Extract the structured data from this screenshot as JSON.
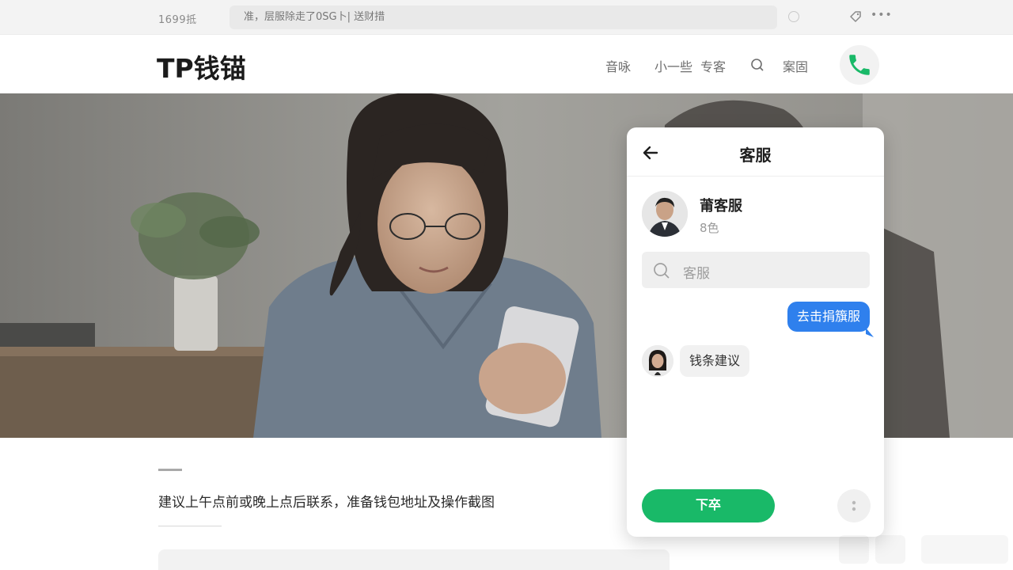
{
  "topbar": {
    "code": "1699抵",
    "notice": "准，层服除走了0SG卜| 送财措",
    "icons": [
      "clock-icon",
      "tag-icon",
      "more-icon"
    ]
  },
  "header": {
    "logo": "TP钱锚",
    "nav": [
      "音咏",
      "小一些",
      "专客",
      "案固"
    ],
    "search_icon": "search-icon",
    "phone_icon": "phone-icon",
    "accent_color": "#19b968"
  },
  "hero": {
    "image": "woman-with-phone-photo"
  },
  "main": {
    "advice": "建议上午点前或晚上点后联系，准备钱包地址及操作截图"
  },
  "chat": {
    "title": "客服",
    "agent_name": "莆客服",
    "agent_status": "8色",
    "search_placeholder": "客服",
    "outgoing_message": "去击捐籏服",
    "incoming_message": "钱条建议",
    "cta_label": "下卒",
    "bubble_color": "#2f80ed"
  }
}
